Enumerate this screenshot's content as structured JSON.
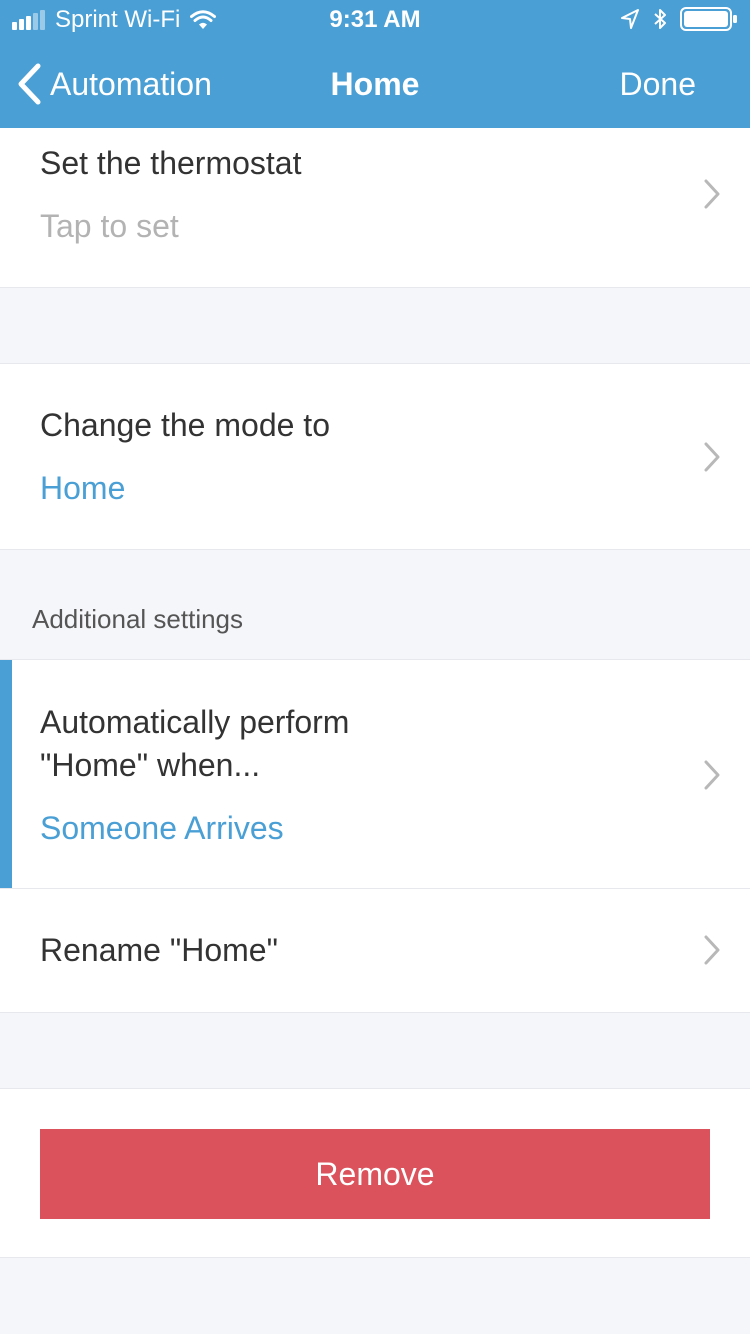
{
  "status_bar": {
    "carrier": "Sprint Wi-Fi",
    "time": "9:31 AM"
  },
  "nav": {
    "back_label": "Automation",
    "title": "Home",
    "done_label": "Done"
  },
  "rows": {
    "thermostat": {
      "title": "Set the thermostat",
      "value": "Tap to set"
    },
    "mode": {
      "title": "Change the mode to",
      "value": "Home"
    },
    "auto": {
      "title_line1": "Automatically perform",
      "title_line2": "\"Home\" when...",
      "value": "Someone Arrives"
    },
    "rename": {
      "title": "Rename \"Home\""
    }
  },
  "section": {
    "additional_settings": "Additional settings"
  },
  "remove_label": "Remove",
  "colors": {
    "header": "#4a9fd5",
    "accent_blue": "#4a9fd5",
    "remove_red": "#db525c",
    "background": "#f5f6fa"
  }
}
